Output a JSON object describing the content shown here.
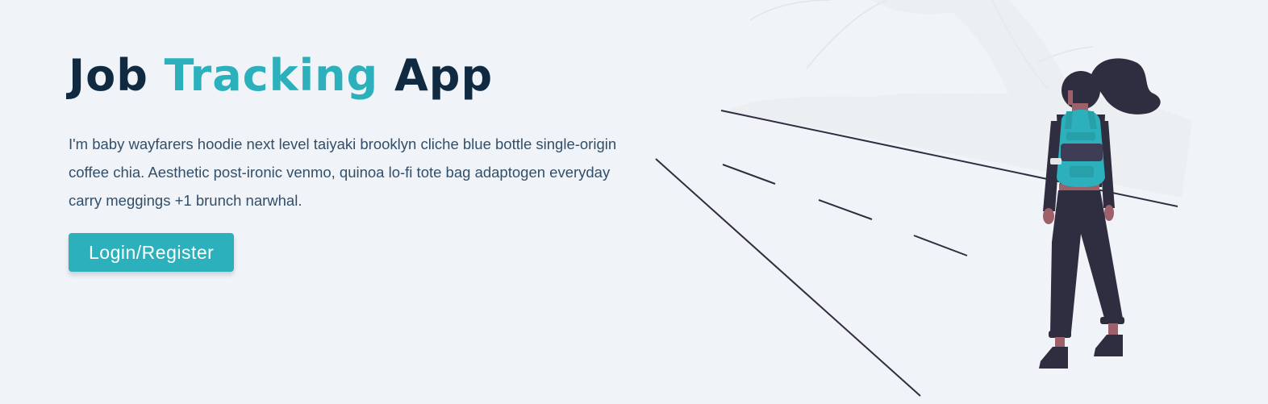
{
  "hero": {
    "title_part1": "Job",
    "title_accent": "Tracking",
    "title_part2": "App",
    "description": "I'm baby wayfarers hoodie next level taiyaki brooklyn cliche blue bottle single-origin coffee chia. Aesthetic post-ironic venmo, quinoa lo-fi tote bag adaptogen everyday carry meggings +1 brunch narwhal.",
    "cta_label": "Login/Register"
  },
  "colors": {
    "primary": "#2cb1bc",
    "heading": "#102a42",
    "text": "#334e68",
    "background": "#f0f4f8",
    "figure_dark": "#2f2e41"
  },
  "illustration": {
    "name": "woman-with-backpack-road-illustration"
  }
}
